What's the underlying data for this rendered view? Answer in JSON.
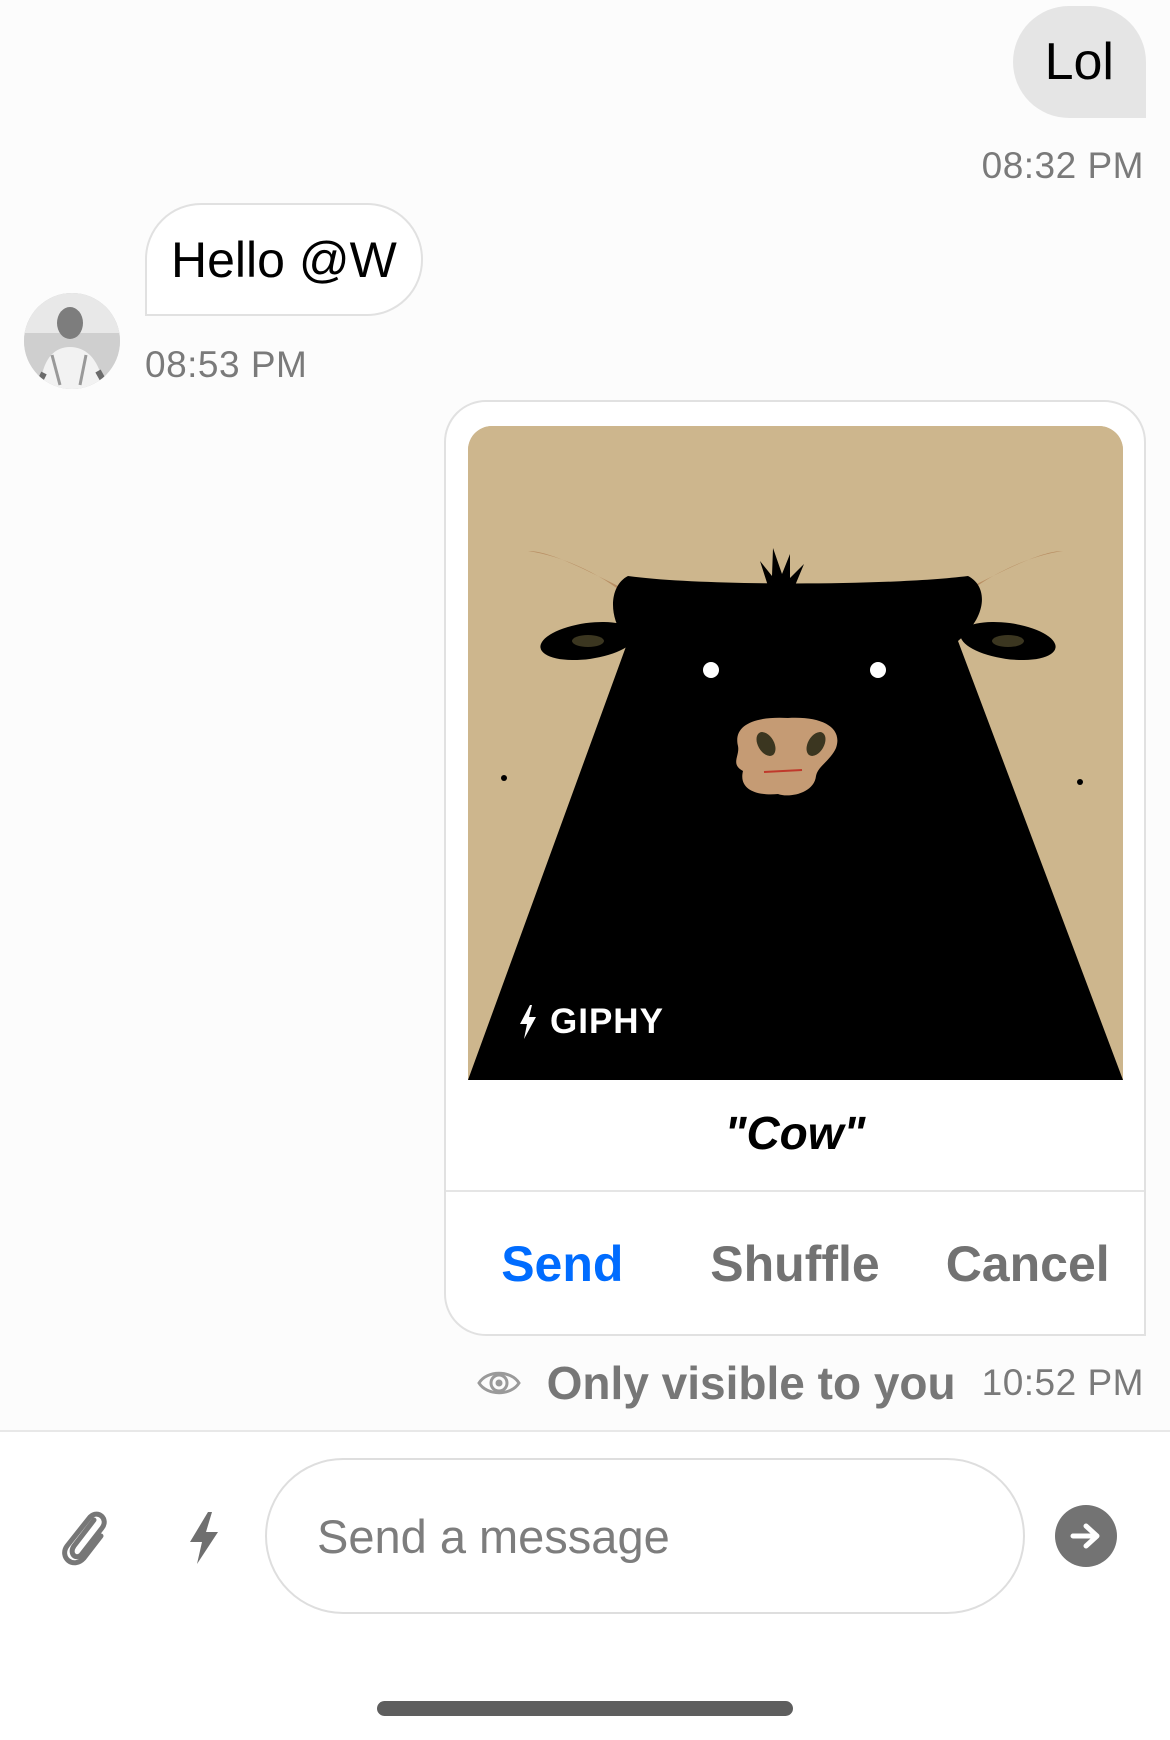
{
  "messages": {
    "outgoing": {
      "text": "Lol",
      "time": "08:32 PM"
    },
    "incoming": {
      "text": "Hello @W",
      "time": "08:53 PM",
      "avatar": "user-avatar"
    }
  },
  "giphy": {
    "attribution": "GIPHY",
    "title": "\"Cow\"",
    "actions": {
      "send": "Send",
      "shuffle": "Shuffle",
      "cancel": "Cancel"
    },
    "visibility": "Only visible to you",
    "time": "10:52 PM"
  },
  "composer": {
    "placeholder": "Send a message",
    "attach_icon": "paperclip-icon",
    "command_icon": "lightning-icon",
    "send_icon": "send-arrow-icon"
  },
  "colors": {
    "accent": "#006cff",
    "outgoing_bubble": "#e5e5e5",
    "muted_text": "#7a7a7a",
    "gif_background": "#cdb68d"
  }
}
